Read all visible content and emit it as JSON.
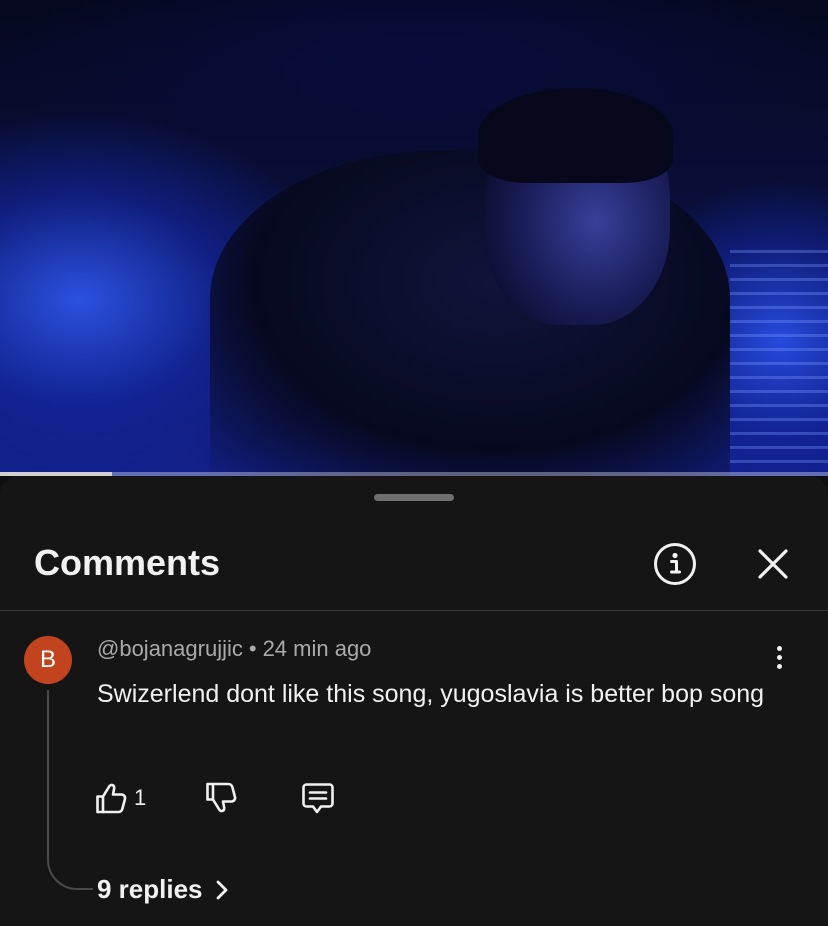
{
  "video": {
    "progress_fraction": 0.135
  },
  "sheet": {
    "title": "Comments",
    "icons": {
      "info": "info-icon",
      "close": "close-icon"
    }
  },
  "comment": {
    "avatar_letter": "B",
    "avatar_color": "#c1441f",
    "author": "@bojanagrujjic",
    "separator": "•",
    "time": "24 min ago",
    "text": "Swizerlend dont like this song, yugoslavia is better bop song",
    "like_count": "1",
    "replies_label": "9 replies",
    "icons": {
      "more": "more-vert-icon",
      "like": "thumbs-up-icon",
      "dislike": "thumbs-down-icon",
      "reply": "reply-comment-icon",
      "replies": "chevron-right-icon"
    }
  }
}
